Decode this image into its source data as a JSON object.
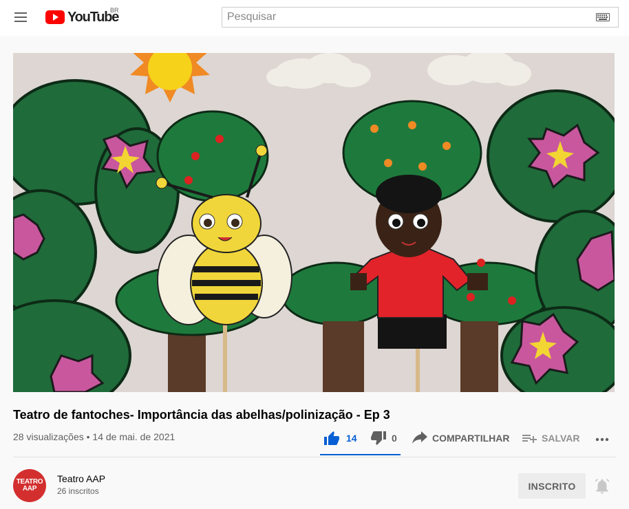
{
  "header": {
    "logo_text": "YouTube",
    "country_code": "BR",
    "search_placeholder": "Pesquisar"
  },
  "video": {
    "title": "Teatro de fantoches- Importância das abelhas/polinização - Ep 3",
    "views": "28 visualizações",
    "separator": "•",
    "date": "14 de mai. de 2021"
  },
  "actions": {
    "likes": "14",
    "dislikes": "0",
    "share_label": "COMPARTILHAR",
    "save_label": "SALVAR",
    "like_ratio": 1.0
  },
  "channel": {
    "name": "Teatro AAP",
    "subscribers": "26 inscritos",
    "avatar_line1": "TEATRO",
    "avatar_line2": "AAP",
    "subscribe_label": "INSCRITO"
  },
  "colors": {
    "accent": "#065fd4",
    "brand_red": "#ff0000",
    "avatar_red": "#d32f2f"
  },
  "icons": [
    "menu-icon",
    "youtube-logo-icon",
    "keyboard-icon",
    "thumbs-up-icon",
    "thumbs-down-icon",
    "share-icon",
    "playlist-add-icon",
    "more-icon",
    "bell-icon"
  ]
}
